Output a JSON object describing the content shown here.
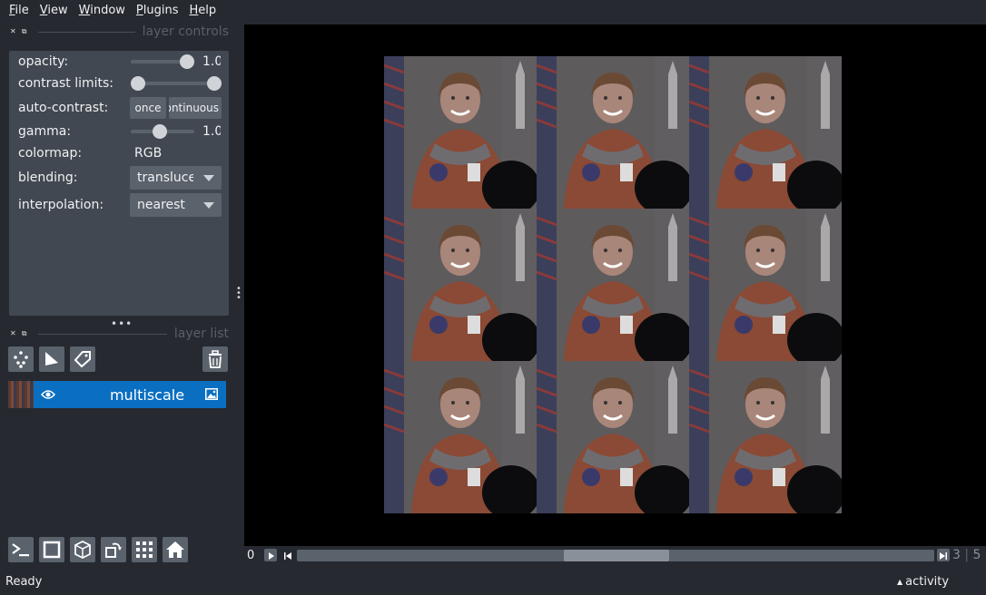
{
  "menubar": {
    "items": [
      {
        "label": "File",
        "u": "F",
        "rest": "ile"
      },
      {
        "label": "View",
        "u": "V",
        "rest": "iew"
      },
      {
        "label": "Window",
        "u": "W",
        "rest": "indow"
      },
      {
        "label": "Plugins",
        "u": "P",
        "rest": "lugins"
      },
      {
        "label": "Help",
        "u": "H",
        "rest": "elp"
      }
    ]
  },
  "layer_controls": {
    "title": "layer controls",
    "opacity_label": "opacity:",
    "opacity_value": 1.0,
    "opacity_text": "1.0",
    "contrast_label": "contrast limits:",
    "contrast_limits": [
      0,
      1
    ],
    "auto_contrast_label": "auto-contrast:",
    "once_label": "once",
    "continuous_label": "continuous",
    "gamma_label": "gamma:",
    "gamma_value": 1.0,
    "gamma_text": "1.0",
    "colormap_label": "colormap:",
    "colormap_value": "RGB",
    "blending_label": "blending:",
    "blending_value": "translucent",
    "interpolation_label": "interpolation:",
    "interpolation_value": "nearest"
  },
  "layer_list": {
    "title": "layer list",
    "layers": [
      {
        "name": "multiscale",
        "visible": true
      }
    ]
  },
  "dims": {
    "current": "0",
    "slider_fraction": 0.5,
    "index": "3",
    "total": "5"
  },
  "status": {
    "text": "Ready",
    "activity": "activity"
  },
  "colors": {
    "accent": "#0a6fc1",
    "panel": "#414851",
    "background": "#262930"
  }
}
